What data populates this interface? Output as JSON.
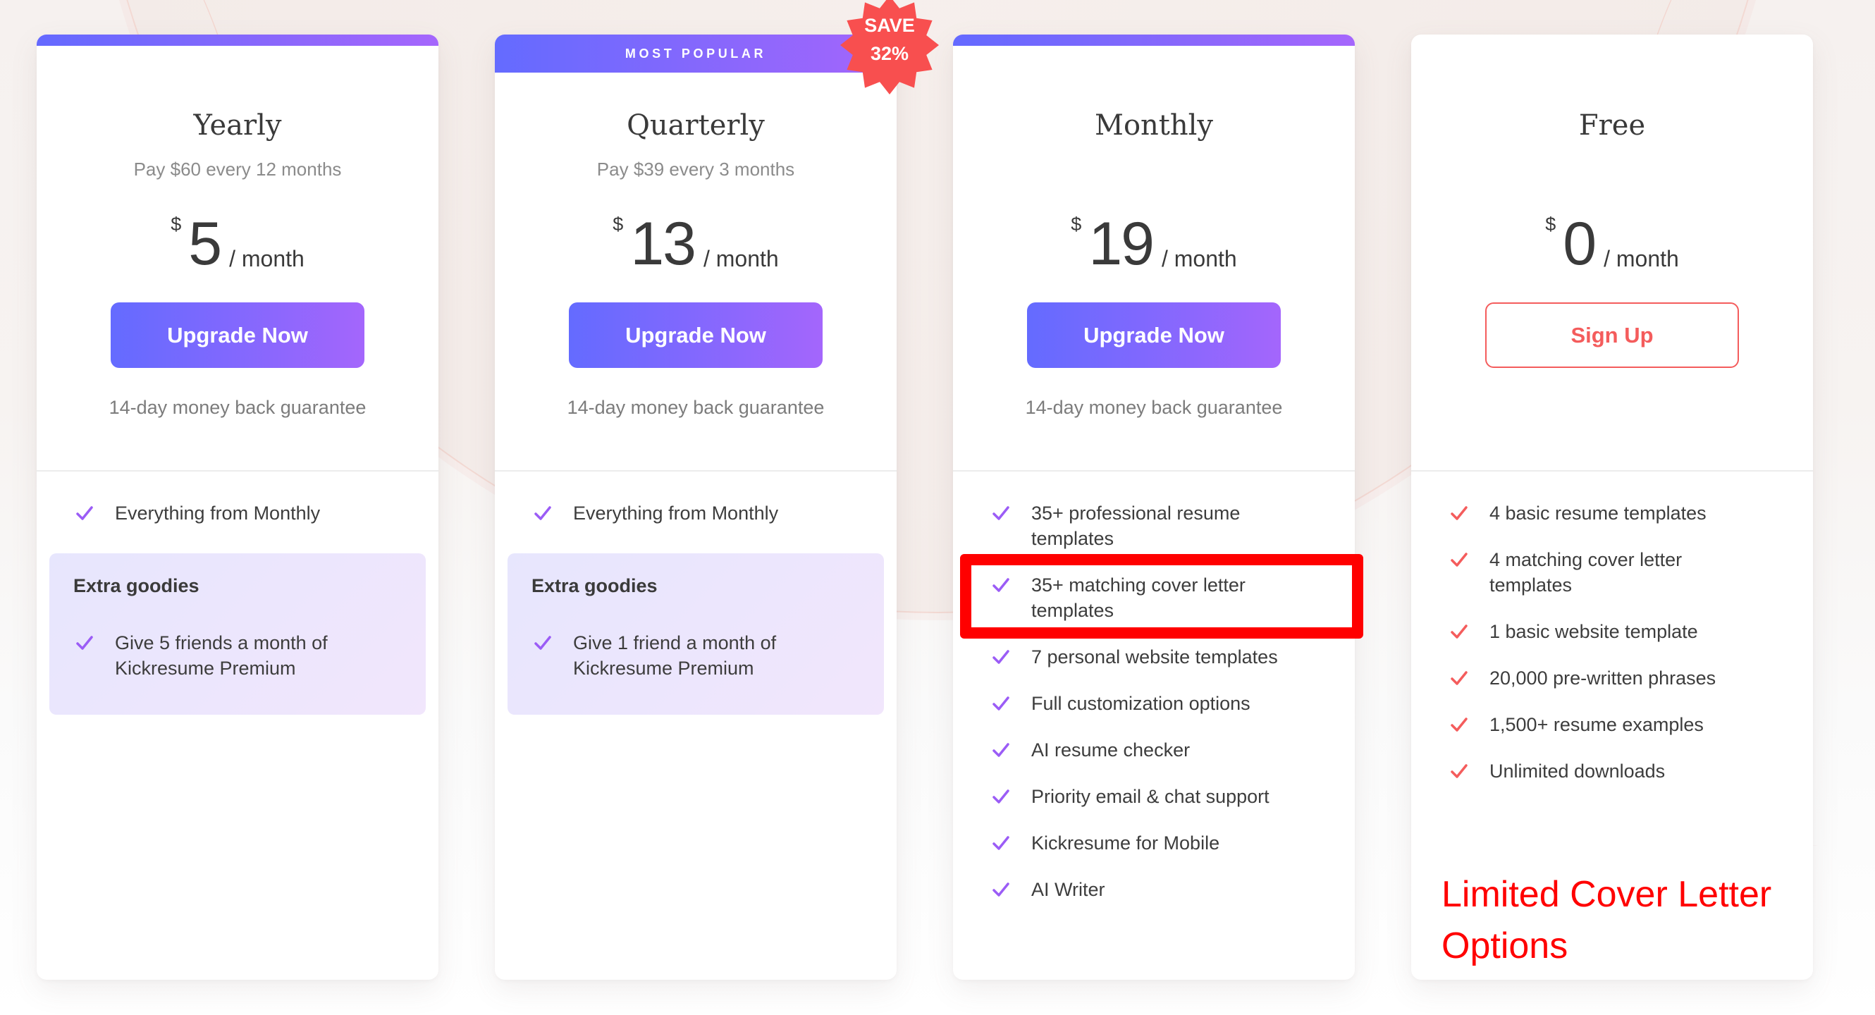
{
  "colors": {
    "accent_start": "#646bff",
    "accent_end": "#a566fc",
    "free_accent": "#f45c5c",
    "badge": "#f84f4f",
    "annotation": "#ff0000",
    "check_purple": "#9b5cf6"
  },
  "plans": [
    {
      "id": "yearly",
      "title": "Yearly",
      "subtitle": "Pay $60 every 12 months",
      "currency": "$",
      "amount": "5",
      "period": "/ month",
      "button_label": "Upgrade Now",
      "guarantee": "14-day money back guarantee",
      "features": [
        "Everything from Monthly"
      ],
      "extra": {
        "title": "Extra goodies",
        "items": [
          "Give 5 friends a month of Kickresume Premium"
        ]
      }
    },
    {
      "id": "quarterly",
      "header_label": "MOST POPULAR",
      "title": "Quarterly",
      "subtitle": "Pay $39 every 3 months",
      "currency": "$",
      "amount": "13",
      "period": "/ month",
      "button_label": "Upgrade Now",
      "guarantee": "14-day money back guarantee",
      "features": [
        "Everything from Monthly"
      ],
      "extra": {
        "title": "Extra goodies",
        "items": [
          "Give 1 friend a month of Kickresume Premium"
        ]
      },
      "badge": {
        "line1": "SAVE",
        "line2": "32%"
      }
    },
    {
      "id": "monthly",
      "title": "Monthly",
      "currency": "$",
      "amount": "19",
      "period": "/ month",
      "button_label": "Upgrade Now",
      "guarantee": "14-day money back guarantee",
      "features": [
        "35+ professional resume templates",
        "35+ matching cover letter templates",
        "7 personal website templates",
        "Full customization options",
        "AI resume checker",
        "Priority email & chat support",
        "Kickresume for Mobile",
        "AI Writer"
      ]
    },
    {
      "id": "free",
      "title": "Free",
      "currency": "$",
      "amount": "0",
      "period": "/ month",
      "button_label": "Sign Up",
      "features": [
        "4 basic resume templates",
        "4 matching cover letter templates",
        "1 basic website template",
        "20,000 pre-written phrases",
        "1,500+ resume examples",
        "Unlimited downloads"
      ]
    }
  ],
  "annotation": {
    "highlighted_feature": "35+ matching cover letter templates",
    "label": "Limited Cover Letter Options"
  }
}
